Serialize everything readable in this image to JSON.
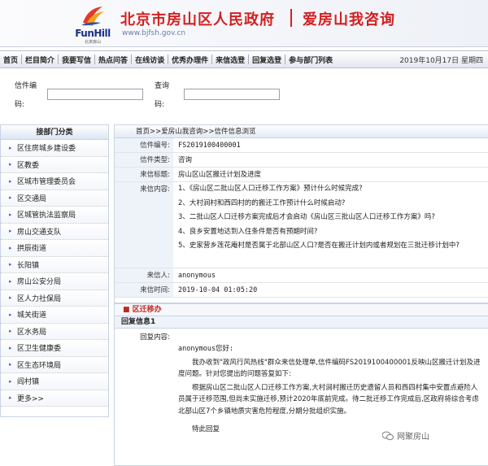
{
  "header": {
    "logo_text": "FunHill",
    "logo_sub": "北京房山",
    "site_title": "北京市房山区人民政府",
    "site_url": "www.bjfsh.gov.cn",
    "page_heading": "爱房山我咨询"
  },
  "nav": {
    "items": [
      "首页",
      "栏目简介",
      "我要写信",
      "热点问答",
      "在线访谈",
      "优秀办理件",
      "来信选登",
      "回复选登",
      "参与部门列表"
    ],
    "date": "2019年10月17日 星期四"
  },
  "search": {
    "letter_no_label": "信件编",
    "letter_no_label2": "码:",
    "query_label": "查询",
    "query_label2": "码:",
    "letter_no_value": "",
    "query_value": ""
  },
  "sidebar": {
    "title": "接部门分类",
    "items": [
      "区住房城乡建设委",
      "区教委",
      "区城市管理委员会",
      "区交通局",
      "区城管执法监察局",
      "房山交通支队",
      "拱辰街道",
      "长阳镇",
      "房山公安分局",
      "区人力社保局",
      "城关街道",
      "区水务局",
      "区卫生健康委",
      "区生态环境局",
      "阎村镇",
      "更多>>"
    ]
  },
  "main": {
    "breadcrumb": "首页>>爱房山我咨询>>信件信息浏览",
    "fields": {
      "letter_no_label": "信件编号:",
      "letter_no": "FS2019100400001",
      "letter_type_label": "信件类型:",
      "letter_type": "咨询",
      "subject_label": "来信标题:",
      "subject": "房山区山区搬迁计划及进度",
      "content_label": "来信内容:",
      "questions": [
        "1、《房山区二批山区人口迁移工作方案》预计什么时候完成?",
        "2、大村涧村和西四村的的搬迁工作预计什么时候启动?",
        "3、二批山区人口迁移方案完成后才会启动《房山区三批山区人口迁移工作方案》吗?",
        "4、良乡安置地达到入住条件是否有预期时间?",
        "5、史家营乡莲花庵村是否属于北部山区人口?是否在搬迁计划内或者规划在三批迁移计划中?"
      ],
      "sender_label": "来信人:",
      "sender": "anonymous",
      "time_label": "来信时间:",
      "time": "2019-10-04 01:05:20"
    },
    "section_tab": "区迁移办",
    "reply": {
      "header": "回复信息1",
      "label": "回复内容:",
      "greeting": "anonymous您好:",
      "para1": "我办收到\"政风行风热线\"群众来信处理单,信件编码FS2019100400001反映山区搬迁计划及进度问题。针对您提出的问题答复如下:",
      "para2": "根据房山区二批山区人口迁移工作方案,大村涧村搬迁历史遗留人员和西四村集中安置点避险人员属于迁移范围,但尚未实施迁移,预计2020年底前完成。待二批迁移工作完成后,区政府将综合考虑北部山区7个乡镇地质灾害危险程度,分期分批组织实施。",
      "closing": "特此回复"
    }
  },
  "watermark": "网聚房山",
  "colors": {
    "title_red": "#d41f1f",
    "section_red": "#c0281f",
    "logo_blue": "#1a2f86"
  }
}
